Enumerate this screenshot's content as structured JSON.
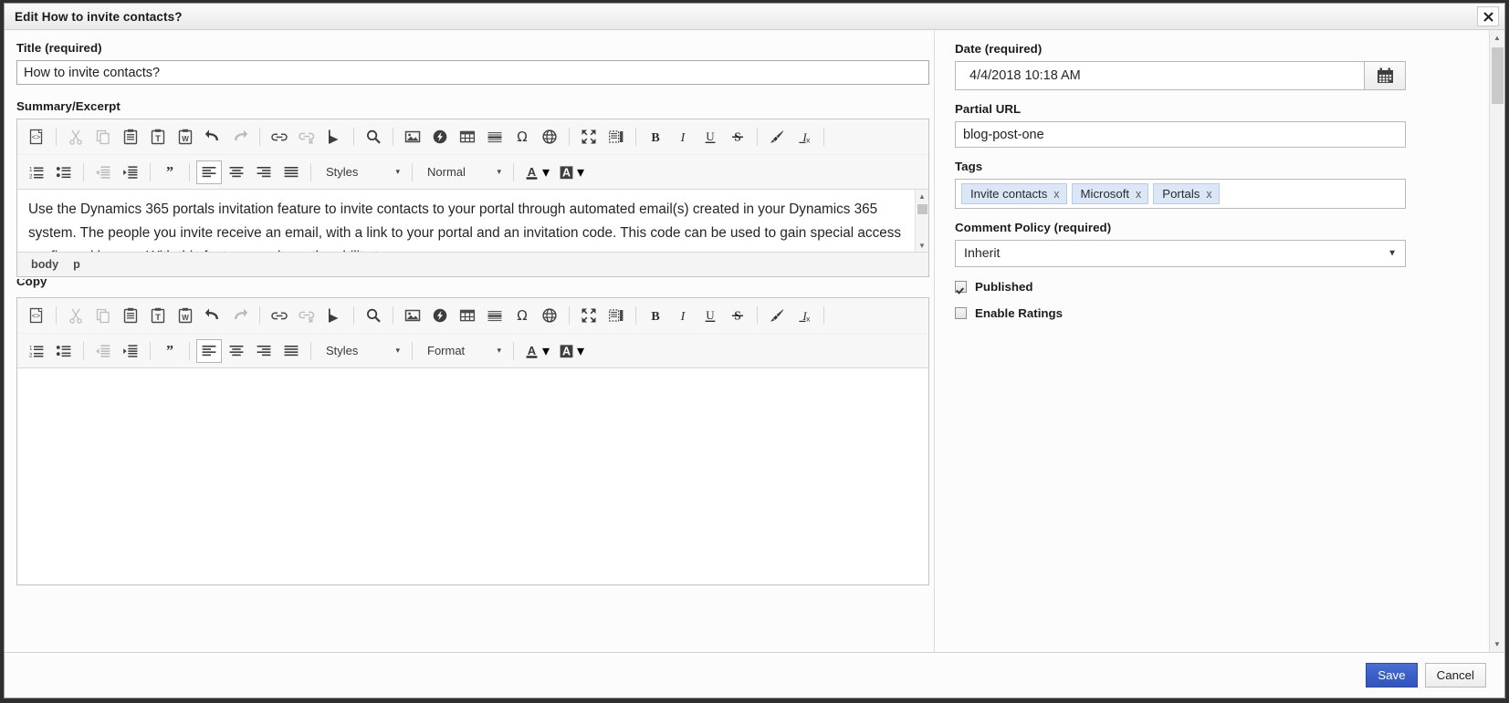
{
  "window": {
    "title": "Edit How to invite contacts?",
    "close_icon": "close-icon"
  },
  "left": {
    "title": {
      "label": "Title (required)",
      "value": "How to invite contacts?"
    },
    "summary": {
      "label": "Summary/Excerpt",
      "body_text": "Use the Dynamics 365 portals invitation feature to invite contacts to your portal through automated email(s) created in your Dynamics 365 system. The people you invite receive an email, with a link to your portal and an invitation code. This code can be used to gain special access configured by you. With this feature you have the ability to:",
      "elements_path": [
        "body",
        "p"
      ]
    },
    "copy": {
      "label": "Copy",
      "body_text": ""
    }
  },
  "editor_toolbar": {
    "row1": [
      {
        "name": "source-icon",
        "title": "Source",
        "glyph": "source",
        "state": "enabled"
      },
      {
        "name": "separator",
        "glyph": "sep"
      },
      {
        "name": "cut-icon",
        "title": "Cut",
        "glyph": "cut",
        "state": "disabled"
      },
      {
        "name": "copy-icon",
        "title": "Copy",
        "glyph": "copy",
        "state": "disabled"
      },
      {
        "name": "paste-icon",
        "title": "Paste",
        "glyph": "paste",
        "state": "enabled"
      },
      {
        "name": "paste-as-text-icon",
        "title": "Paste as plain text",
        "glyph": "paste-text",
        "state": "enabled"
      },
      {
        "name": "paste-from-word-icon",
        "title": "Paste from Word",
        "glyph": "paste-word",
        "state": "enabled"
      },
      {
        "name": "undo-icon",
        "title": "Undo",
        "glyph": "undo",
        "state": "enabled"
      },
      {
        "name": "redo-icon",
        "title": "Redo",
        "glyph": "redo",
        "state": "disabled"
      },
      {
        "name": "separator",
        "glyph": "sep"
      },
      {
        "name": "link-icon",
        "title": "Link",
        "glyph": "link",
        "state": "enabled"
      },
      {
        "name": "unlink-icon",
        "title": "Unlink",
        "glyph": "unlink",
        "state": "disabled"
      },
      {
        "name": "anchor-icon",
        "title": "Anchor",
        "glyph": "anchor",
        "state": "enabled"
      },
      {
        "name": "separator",
        "glyph": "sep"
      },
      {
        "name": "find-icon",
        "title": "Find",
        "glyph": "find",
        "state": "enabled"
      },
      {
        "name": "separator",
        "glyph": "sep"
      },
      {
        "name": "image-icon",
        "title": "Image",
        "glyph": "image",
        "state": "enabled"
      },
      {
        "name": "flash-icon",
        "title": "Flash",
        "glyph": "flash",
        "state": "enabled"
      },
      {
        "name": "table-icon",
        "title": "Table",
        "glyph": "table",
        "state": "enabled"
      },
      {
        "name": "horizontal-rule-icon",
        "title": "Horizontal Line",
        "glyph": "hr",
        "state": "enabled"
      },
      {
        "name": "special-character-icon",
        "title": "Insert Special Character",
        "glyph": "omega",
        "state": "enabled"
      },
      {
        "name": "iframe-icon",
        "title": "IFrame",
        "glyph": "globe",
        "state": "enabled"
      },
      {
        "name": "separator",
        "glyph": "sep"
      },
      {
        "name": "maximize-icon",
        "title": "Maximize",
        "glyph": "maximize",
        "state": "enabled"
      },
      {
        "name": "show-blocks-icon",
        "title": "Show Blocks",
        "glyph": "blocks",
        "state": "enabled"
      },
      {
        "name": "separator",
        "glyph": "sep"
      },
      {
        "name": "bold-icon",
        "title": "Bold",
        "glyph": "bold",
        "state": "enabled"
      },
      {
        "name": "italic-icon",
        "title": "Italic",
        "glyph": "italic",
        "state": "enabled"
      },
      {
        "name": "underline-icon",
        "title": "Underline",
        "glyph": "underline",
        "state": "enabled"
      },
      {
        "name": "strikethrough-icon",
        "title": "Strikethrough",
        "glyph": "strike",
        "state": "enabled"
      },
      {
        "name": "separator",
        "glyph": "sep"
      },
      {
        "name": "copy-formatting-icon",
        "title": "Copy Formatting",
        "glyph": "brush",
        "state": "enabled"
      },
      {
        "name": "remove-format-icon",
        "title": "Remove Format",
        "glyph": "removeformat",
        "state": "enabled"
      },
      {
        "name": "separator",
        "glyph": "sep"
      }
    ],
    "row2": [
      {
        "name": "numbered-list-icon",
        "title": "Insert/Remove Numbered List",
        "glyph": "numlist",
        "state": "enabled"
      },
      {
        "name": "bulleted-list-icon",
        "title": "Insert/Remove Bulleted List",
        "glyph": "bullist",
        "state": "enabled"
      },
      {
        "name": "separator",
        "glyph": "sep"
      },
      {
        "name": "outdent-icon",
        "title": "Decrease Indent",
        "glyph": "outdent",
        "state": "disabled"
      },
      {
        "name": "indent-icon",
        "title": "Increase Indent",
        "glyph": "indent",
        "state": "enabled"
      },
      {
        "name": "separator",
        "glyph": "sep"
      },
      {
        "name": "blockquote-icon",
        "title": "Block Quote",
        "glyph": "quote",
        "state": "enabled"
      },
      {
        "name": "separator",
        "glyph": "sep"
      },
      {
        "name": "align-left-icon",
        "title": "Align Left",
        "glyph": "alignleft",
        "state": "active"
      },
      {
        "name": "align-center-icon",
        "title": "Center",
        "glyph": "aligncenter",
        "state": "enabled"
      },
      {
        "name": "align-right-icon",
        "title": "Align Right",
        "glyph": "alignright",
        "state": "enabled"
      },
      {
        "name": "justify-icon",
        "title": "Justify",
        "glyph": "justify",
        "state": "enabled"
      },
      {
        "name": "separator",
        "glyph": "sep"
      }
    ],
    "styles_label": "Styles",
    "format_label_summary": "Normal",
    "format_label_copy": "Format",
    "text_color_icon": "text-color-icon",
    "bg_color_icon": "background-color-icon"
  },
  "right": {
    "date": {
      "label": "Date (required)",
      "value": "4/4/2018 10:18 AM",
      "picker_icon": "calendar-icon"
    },
    "partial_url": {
      "label": "Partial URL",
      "value": "blog-post-one"
    },
    "tags": {
      "label": "Tags",
      "items": [
        {
          "text": "Invite contacts",
          "remove": "x"
        },
        {
          "text": "Microsoft",
          "remove": "x"
        },
        {
          "text": "Portals",
          "remove": "x"
        }
      ]
    },
    "comment_policy": {
      "label": "Comment Policy (required)",
      "value": "Inherit"
    },
    "published": {
      "label": "Published",
      "checked": true
    },
    "enable_ratings": {
      "label": "Enable Ratings",
      "checked": false
    }
  },
  "footer": {
    "save_label": "Save",
    "cancel_label": "Cancel"
  },
  "colors": {
    "primary": "#3a5fc8",
    "tag_bg": "#dbe6f7",
    "toolbar_bg": "#f7f7f7"
  }
}
